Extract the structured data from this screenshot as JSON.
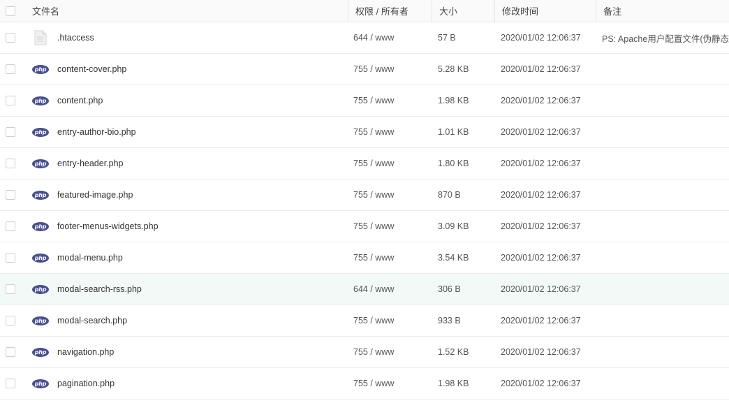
{
  "header": {
    "name": "文件名",
    "permission": "权限 / 所有者",
    "size": "大小",
    "modified": "修改时间",
    "note": "备注"
  },
  "files": [
    {
      "icon": "text-file-icon",
      "name": ".htaccess",
      "permission": "644 / www",
      "size": "57 B",
      "modified": "2020/01/02 12:06:37",
      "note": "PS: Apache用户配置文件(伪静态)"
    },
    {
      "icon": "php-file-icon",
      "name": "content-cover.php",
      "permission": "755 / www",
      "size": "5.28 KB",
      "modified": "2020/01/02 12:06:37",
      "note": ""
    },
    {
      "icon": "php-file-icon",
      "name": "content.php",
      "permission": "755 / www",
      "size": "1.98 KB",
      "modified": "2020/01/02 12:06:37",
      "note": ""
    },
    {
      "icon": "php-file-icon",
      "name": "entry-author-bio.php",
      "permission": "755 / www",
      "size": "1.01 KB",
      "modified": "2020/01/02 12:06:37",
      "note": ""
    },
    {
      "icon": "php-file-icon",
      "name": "entry-header.php",
      "permission": "755 / www",
      "size": "1.80 KB",
      "modified": "2020/01/02 12:06:37",
      "note": ""
    },
    {
      "icon": "php-file-icon",
      "name": "featured-image.php",
      "permission": "755 / www",
      "size": "870 B",
      "modified": "2020/01/02 12:06:37",
      "note": ""
    },
    {
      "icon": "php-file-icon",
      "name": "footer-menus-widgets.php",
      "permission": "755 / www",
      "size": "3.09 KB",
      "modified": "2020/01/02 12:06:37",
      "note": ""
    },
    {
      "icon": "php-file-icon",
      "name": "modal-menu.php",
      "permission": "755 / www",
      "size": "3.54 KB",
      "modified": "2020/01/02 12:06:37",
      "note": ""
    },
    {
      "icon": "php-file-icon",
      "name": "modal-search-rss.php",
      "permission": "644 / www",
      "size": "306 B",
      "modified": "2020/01/02 12:06:37",
      "note": "",
      "highlighted": true
    },
    {
      "icon": "php-file-icon",
      "name": "modal-search.php",
      "permission": "755 / www",
      "size": "933 B",
      "modified": "2020/01/02 12:06:37",
      "note": ""
    },
    {
      "icon": "php-file-icon",
      "name": "navigation.php",
      "permission": "755 / www",
      "size": "1.52 KB",
      "modified": "2020/01/02 12:06:37",
      "note": ""
    },
    {
      "icon": "php-file-icon",
      "name": "pagination.php",
      "permission": "755 / www",
      "size": "1.98 KB",
      "modified": "2020/01/02 12:06:37",
      "note": ""
    }
  ],
  "icons": {
    "php_label": "php"
  },
  "colors": {
    "php_badge": "#4a4f8c",
    "row_hover": "#f2f9f6",
    "border": "#ececec"
  }
}
